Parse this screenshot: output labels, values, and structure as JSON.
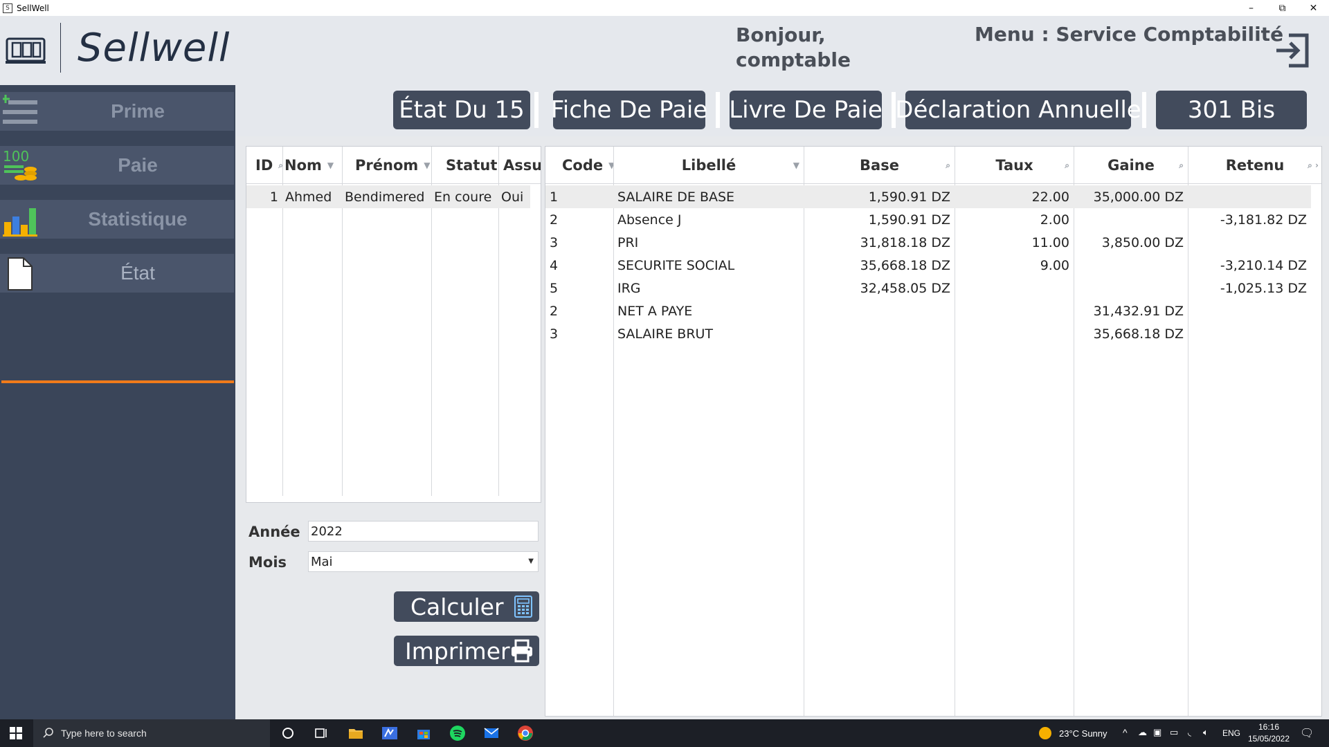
{
  "window": {
    "title": "SellWell",
    "minimize": "–",
    "restore": "⧉",
    "close": "✕"
  },
  "header": {
    "brand": "Sellwell",
    "greeting": "Bonjour, comptable",
    "menu_title": "Menu : Service Comptabilité"
  },
  "sidebar": {
    "items": [
      {
        "label": "Prime",
        "icon": "list-add-icon"
      },
      {
        "label": "Paie",
        "icon": "coins-icon",
        "icon_text": "100"
      },
      {
        "label": "Statistique",
        "icon": "bar-chart-icon"
      },
      {
        "label": "État",
        "icon": "document-icon",
        "active": true
      }
    ],
    "accent": "#f07a1a"
  },
  "tabs": [
    {
      "label": "État Du 15"
    },
    {
      "label": "Fiche De Paie"
    },
    {
      "label": "Livre De Paie"
    },
    {
      "label": "Déclaration Annuelle"
    },
    {
      "label": "301 Bis"
    }
  ],
  "employees": {
    "columns": [
      "ID",
      "Nom",
      "Prénom",
      "Statut",
      "Assu"
    ],
    "rows": [
      {
        "id": "1",
        "nom": "Ahmed",
        "prenom": "Bendimered",
        "statut": "En coure",
        "assu": "Oui"
      }
    ]
  },
  "form": {
    "annee_label": "Année",
    "annee_value": "2022",
    "mois_label": "Mois",
    "mois_value": "Mai",
    "calculer": "Calculer",
    "imprimer": "Imprimer"
  },
  "payslip": {
    "columns": [
      "Code",
      "Libellé",
      "Base",
      "Taux",
      "Gaine",
      "Retenu"
    ],
    "rows": [
      {
        "code": "1",
        "libelle": "SALAIRE DE BASE",
        "base": "1,590.91 DZ",
        "taux": "22.00",
        "gaine": "35,000.00 DZ",
        "retenu": ""
      },
      {
        "code": "2",
        "libelle": "Absence J",
        "base": "1,590.91 DZ",
        "taux": "2.00",
        "gaine": "",
        "retenu": "-3,181.82 DZ"
      },
      {
        "code": "3",
        "libelle": "PRI",
        "base": "31,818.18 DZ",
        "taux": "11.00",
        "gaine": "3,850.00 DZ",
        "retenu": ""
      },
      {
        "code": "4",
        "libelle": "SECURITE SOCIAL",
        "base": "35,668.18 DZ",
        "taux": "9.00",
        "gaine": "",
        "retenu": "-3,210.14 DZ"
      },
      {
        "code": "5",
        "libelle": "IRG",
        "base": "32,458.05 DZ",
        "taux": "",
        "gaine": "",
        "retenu": "-1,025.13 DZ"
      },
      {
        "code": "2",
        "libelle": "NET A PAYE",
        "base": "",
        "taux": "",
        "gaine": "31,432.91 DZ",
        "retenu": ""
      },
      {
        "code": "3",
        "libelle": "SALAIRE BRUT",
        "base": "",
        "taux": "",
        "gaine": "35,668.18 DZ",
        "retenu": ""
      }
    ]
  },
  "taskbar": {
    "search_placeholder": "Type here to search",
    "weather": "23°C  Sunny",
    "lang": "ENG",
    "time": "16:16",
    "date": "15/05/2022"
  }
}
